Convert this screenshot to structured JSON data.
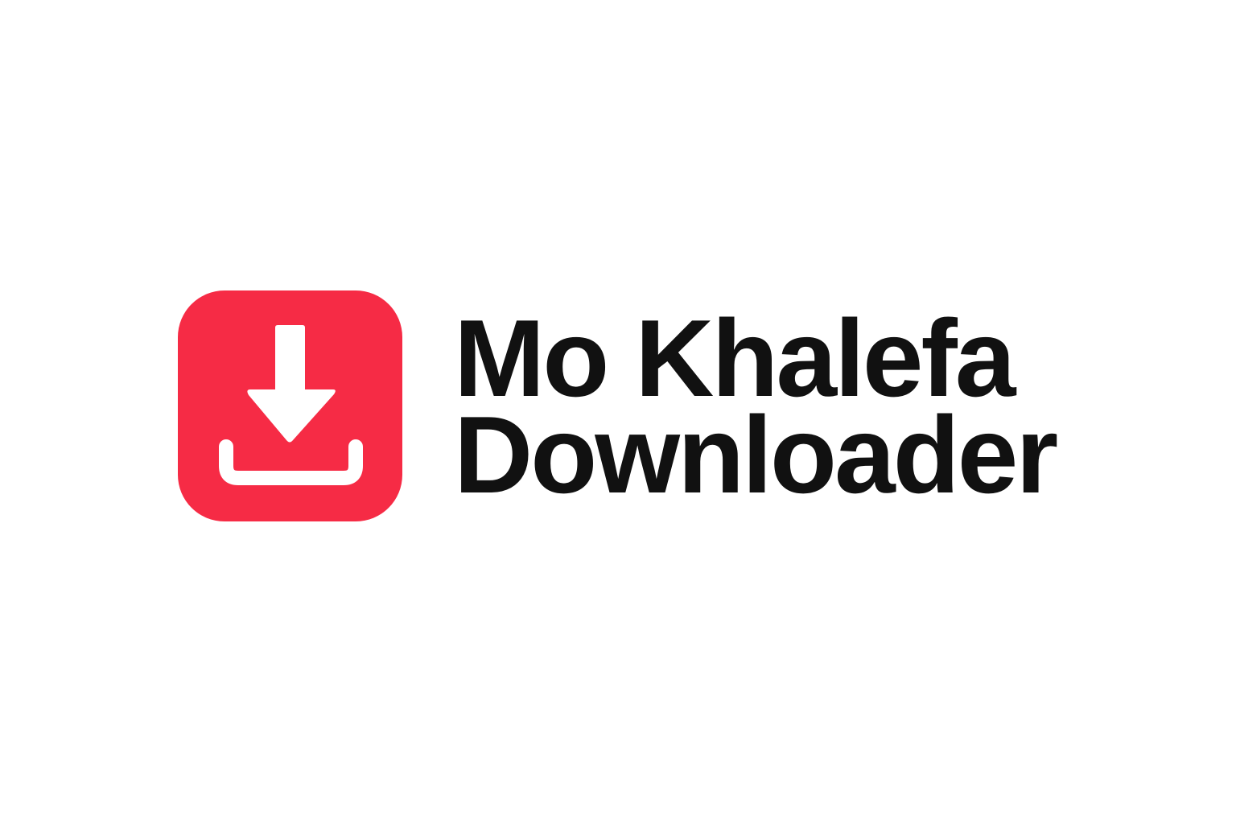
{
  "brand": {
    "name_line_1": "Mo Khalefa",
    "name_line_2": "Downloader",
    "icon": "download-arrow-tray-icon",
    "icon_background_color": "#f62b45",
    "icon_foreground_color": "#ffffff",
    "text_color": "#111111"
  }
}
